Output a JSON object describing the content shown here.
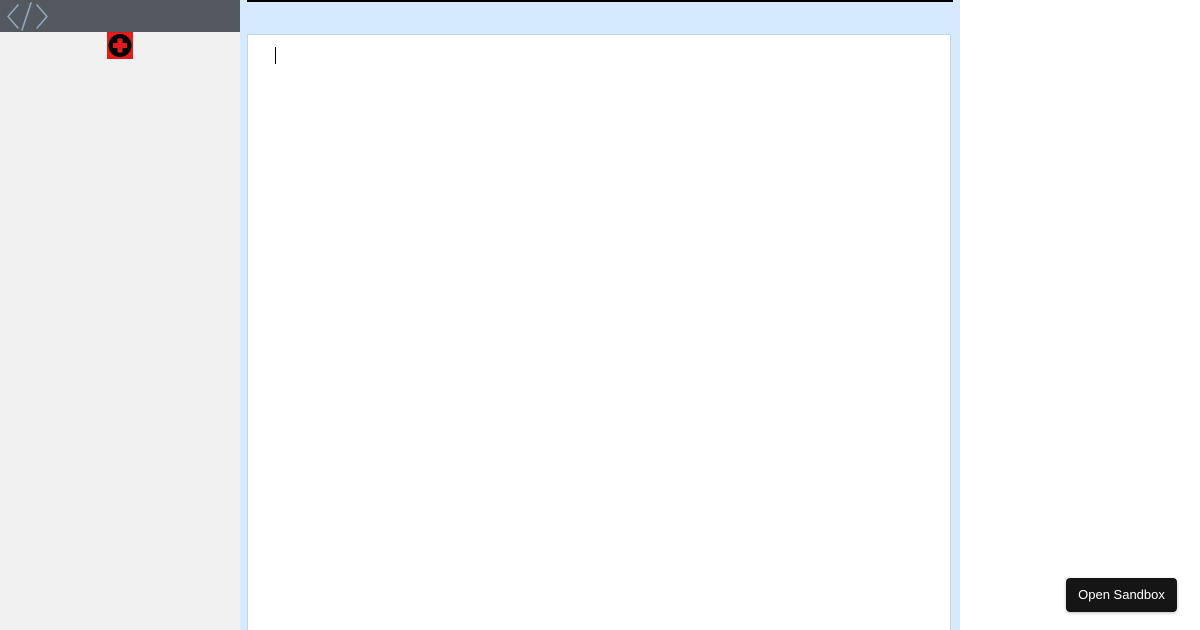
{
  "sidebar": {
    "header_icon": "code-icon",
    "add_icon": "plus-circle-icon",
    "colors": {
      "panel": "#f1f1f1",
      "header": "#54595f",
      "icon": "#8fa7c2",
      "add_bg": "#e41b1b",
      "add_circle": "#000000",
      "add_plus": "#e41b1b"
    }
  },
  "editor": {
    "content": "",
    "colors": {
      "background": "#d5eafd",
      "canvas": "#ffffff",
      "topline": "#000000"
    }
  },
  "actions": {
    "open_sandbox_label": "Open Sandbox"
  }
}
